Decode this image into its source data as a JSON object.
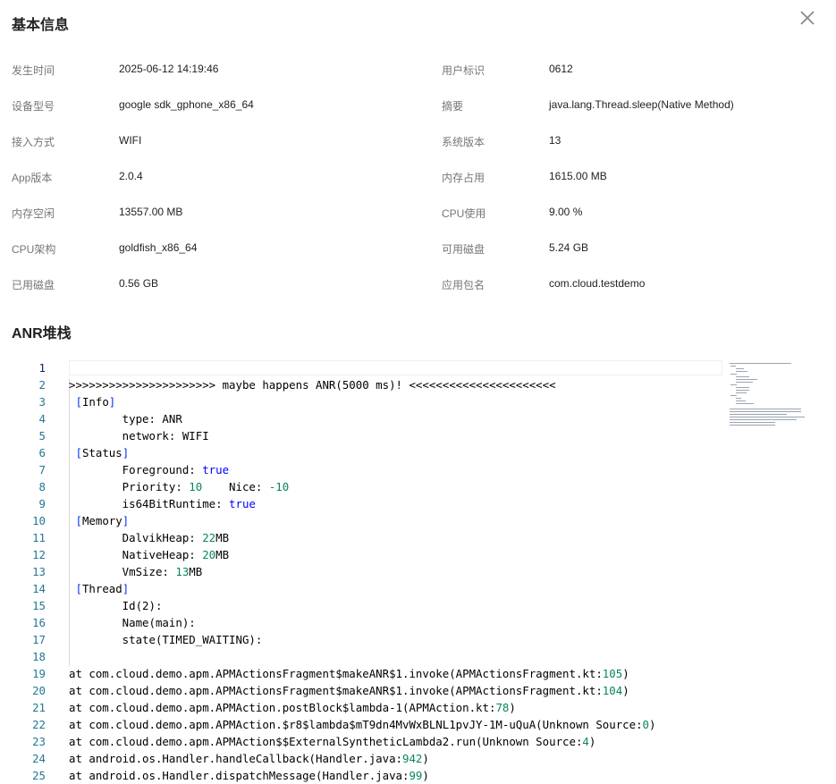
{
  "header": {
    "title": "基本信息",
    "close_icon": "close-icon"
  },
  "info": [
    {
      "l1": "发生时间",
      "v1": "2025-06-12 14:19:46",
      "l2": "用户标识",
      "v2": "0612"
    },
    {
      "l1": "设备型号",
      "v1": "google sdk_gphone_x86_64",
      "l2": "摘要",
      "v2": "java.lang.Thread.sleep(Native Method)"
    },
    {
      "l1": "接入方式",
      "v1": "WIFI",
      "l2": "系统版本",
      "v2": "13"
    },
    {
      "l1": "App版本",
      "v1": "2.0.4",
      "l2": "内存占用",
      "v2": "1615.00 MB"
    },
    {
      "l1": "内存空闲",
      "v1": "13557.00 MB",
      "l2": "CPU使用",
      "v2": "9.00 %"
    },
    {
      "l1": "CPU架构",
      "v1": "goldfish_x86_64",
      "l2": "可用磁盘",
      "v2": "5.24 GB"
    },
    {
      "l1": "已用磁盘",
      "v1": "0.56 GB",
      "l2": "应用包名",
      "v2": "com.cloud.testdemo"
    }
  ],
  "stack": {
    "title": "ANR堆栈",
    "line_numbers": [
      "1",
      "2",
      "3",
      "4",
      "5",
      "6",
      "7",
      "8",
      "9",
      "10",
      "11",
      "12",
      "13",
      "14",
      "15",
      "16",
      "17",
      "18",
      "19",
      "20",
      "21",
      "22",
      "23",
      "24",
      "25"
    ],
    "lines": [
      "",
      ">>>>>>>>>>>>>>>>>>>>>> maybe happens ANR(5000 ms)! <<<<<<<<<<<<<<<<<<<<<<",
      " [Info]",
      "        type: ANR",
      "        network: WIFI",
      " [Status]",
      "        Foreground: true",
      "        Priority: 10    Nice: -10",
      "        is64BitRuntime: true",
      " [Memory]",
      "        DalvikHeap: 22MB",
      "        NativeHeap: 20MB",
      "        VmSize: 13MB",
      " [Thread]",
      "        Id(2):",
      "        Name(main):",
      "        state(TIMED_WAITING):",
      "",
      "at com.cloud.demo.apm.APMActionsFragment$makeANR$1.invoke(APMActionsFragment.kt:105)",
      "at com.cloud.demo.apm.APMActionsFragment$makeANR$1.invoke(APMActionsFragment.kt:104)",
      "at com.cloud.demo.apm.APMAction.postBlock$lambda-1(APMAction.kt:78)",
      "at com.cloud.demo.apm.APMAction.$r8$lambda$mT9dn4MvWxBLNL1pvJY-1M-uQuA(Unknown Source:0)",
      "at com.cloud.demo.apm.APMAction$$ExternalSyntheticLambda2.run(Unknown Source:4)",
      "at android.os.Handler.handleCallback(Handler.java:942)",
      "at android.os.Handler.dispatchMessage(Handler.java:99)"
    ]
  }
}
